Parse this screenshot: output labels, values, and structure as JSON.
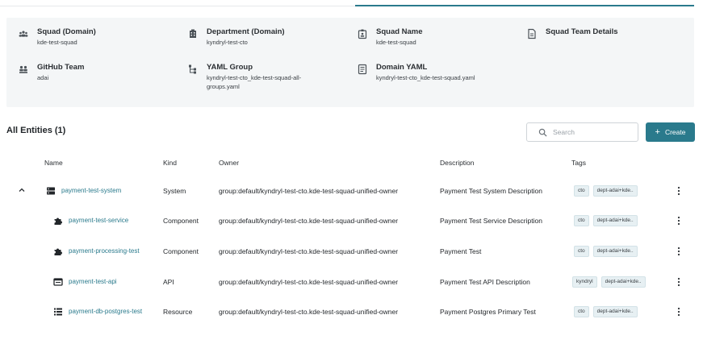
{
  "info": {
    "squad_domain": {
      "label": "Squad (Domain)",
      "value": "kde-test-squad"
    },
    "department_domain": {
      "label": "Department (Domain)",
      "value": "kyndryl-test-cto"
    },
    "squad_name": {
      "label": "Squad Name",
      "value": "kde-test-squad"
    },
    "squad_team_details": {
      "label": "Squad Team Details"
    },
    "github_team": {
      "label": "GitHub Team",
      "value": "adai"
    },
    "yaml_group": {
      "label": "YAML Group",
      "value_line1": "kyndryl-test-cto_kde-test-squad-all-",
      "value_line2": "groups.yaml"
    },
    "domain_yaml": {
      "label": "Domain YAML",
      "value": "kyndryl-test-cto_kde-test-squad.yaml"
    }
  },
  "entities": {
    "title": "All Entities (1)",
    "search_placeholder": "Search",
    "create_label": "Create",
    "columns": {
      "name": "Name",
      "kind": "Kind",
      "owner": "Owner",
      "description": "Description",
      "tags": "Tags"
    },
    "rows": [
      {
        "name": "payment-test-system",
        "kind": "System",
        "owner": "group:default/kyndryl-test-cto.kde-test-squad-unified-owner",
        "description": "Payment Test System Description",
        "tags": [
          "cto",
          "dept-adai+kde.."
        ],
        "icon": "system-icon"
      },
      {
        "name": "payment-test-service",
        "kind": "Component",
        "owner": "group:default/kyndryl-test-cto.kde-test-squad-unified-owner",
        "description": "Payment Test Service Description",
        "tags": [
          "cto",
          "dept-adai+kde.."
        ],
        "icon": "puzzle-icon"
      },
      {
        "name": "payment-processing-test",
        "kind": "Component",
        "owner": "group:default/kyndryl-test-cto.kde-test-squad-unified-owner",
        "description": "Payment Test",
        "tags": [
          "cto",
          "dept-adai+kde.."
        ],
        "icon": "puzzle-icon"
      },
      {
        "name": "payment-test-api",
        "kind": "API",
        "owner": "group:default/kyndryl-test-cto.kde-test-squad-unified-owner",
        "description": "Payment Test API Description",
        "tags": [
          "kyndryl",
          "dept-adai+kde.."
        ],
        "icon": "api-icon"
      },
      {
        "name": "payment-db-postgres-test",
        "kind": "Resource",
        "owner": "group:default/kyndryl-test-cto.kde-test-squad-unified-owner",
        "description": "Payment Postgres Primary Test",
        "tags": [
          "cto",
          "dept-adai+kde.."
        ],
        "icon": "resource-icon"
      }
    ]
  },
  "colors": {
    "accent": "#2a7a8c",
    "panel": "#f4f6f7"
  }
}
